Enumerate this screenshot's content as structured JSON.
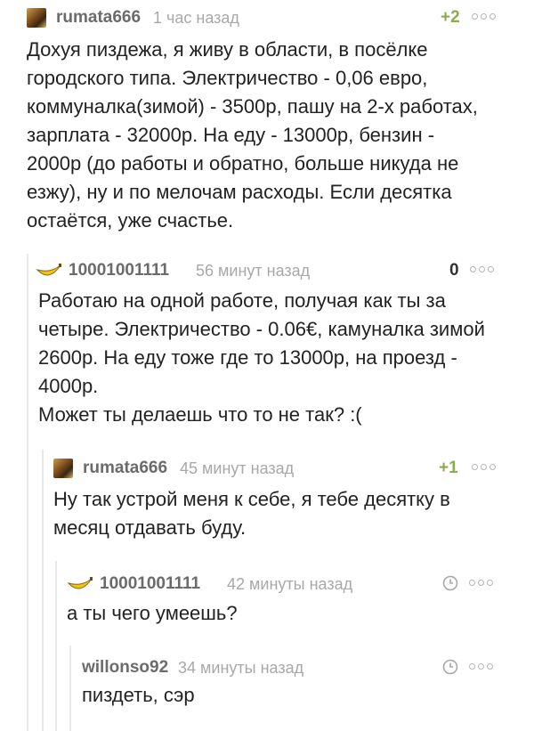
{
  "comments": [
    {
      "username": "rumata666",
      "time": "1 час назад",
      "rating": "+2",
      "text": "Дохуя пиздежа, я живу в области, в посёлке\nгородского типа. Электричество - 0,06 евро,\nкоммуналка(зимой) - 3500р, пашу на 2-х работах,\nзарплата - 32000р. На еду - 13000р, бензин -\n2000р (до работы и обратно, больше никуда не\nезжу), ну и по мелочам расходы. Если десятка\nостаётся, уже счастье.",
      "avatar_icon": "user-avatar-icon"
    },
    {
      "username": "10001001111",
      "time": "56 минут назад",
      "rating": "0",
      "text": "Работаю на одной работе, получая как ты за\nчетыре. Электричество - 0.06€, камуналка зимой\n2600р. На еду тоже где то 13000р, на проезд -\n4000р.\nМожет ты делаешь что то не так? :(",
      "avatar_icon": "banana-icon"
    },
    {
      "username": "rumata666",
      "time": "45 минут назад",
      "rating": "+1",
      "text": "Ну так устрой меня к себе, я тебе десятку в\nмесяц отдавать буду.",
      "avatar_icon": "user-avatar-icon"
    },
    {
      "username": "10001001111",
      "time": "42 минуты назад",
      "text": "а ты чего умеешь?",
      "avatar_icon": "banana-icon",
      "rating_icon": "clock-icon"
    },
    {
      "username": "willonso92",
      "time": "34 минуты назад",
      "text": "пиздеть, сэр",
      "rating_icon": "clock-icon"
    }
  ],
  "colors": {
    "username": "#6b6b6b",
    "timestamp": "#a8a8a8",
    "positive_rating": "#8aac4a",
    "thread_line": "#e8e8e8"
  }
}
